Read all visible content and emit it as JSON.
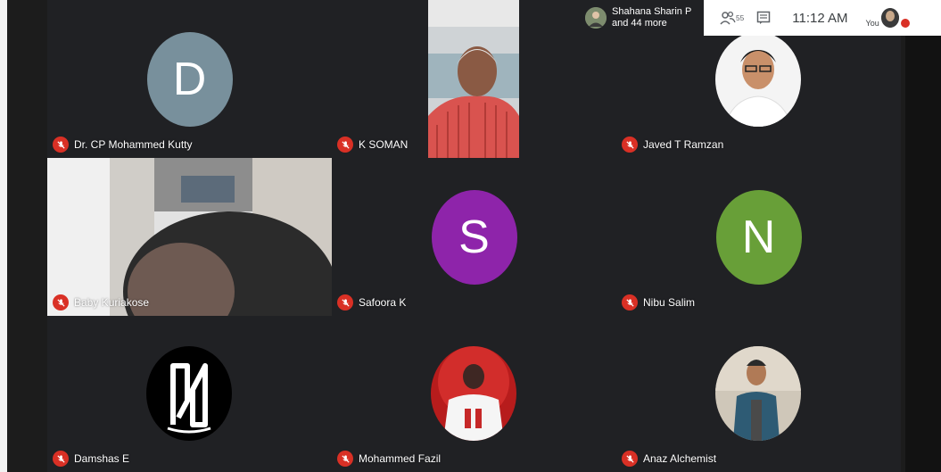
{
  "presenter": {
    "line1": "Shahana Sharin P",
    "line2": "and 44 more"
  },
  "toolbar": {
    "participants_count": "55",
    "time": "11:12 AM",
    "you_label": "You"
  },
  "participants": [
    {
      "name": "Dr. CP Mohammed Kutty",
      "initial": "D",
      "avatar_color": "#78909c",
      "type": "initial"
    },
    {
      "name": "K SOMAN",
      "type": "video"
    },
    {
      "name": "Javed T Ramzan",
      "type": "photo"
    },
    {
      "name": "Baby Kuriakose",
      "type": "video"
    },
    {
      "name": "Safoora K",
      "initial": "S",
      "avatar_color": "#8e24aa",
      "type": "initial"
    },
    {
      "name": "Nibu Salim",
      "initial": "N",
      "avatar_color": "#689f38",
      "type": "initial"
    },
    {
      "name": "Damshas E",
      "type": "photo"
    },
    {
      "name": "Mohammed Fazil",
      "type": "photo"
    },
    {
      "name": "Anaz Alchemist",
      "type": "photo"
    }
  ],
  "icons": {
    "mic_off": "mic-off-icon",
    "people": "people-icon",
    "chat": "chat-icon"
  }
}
